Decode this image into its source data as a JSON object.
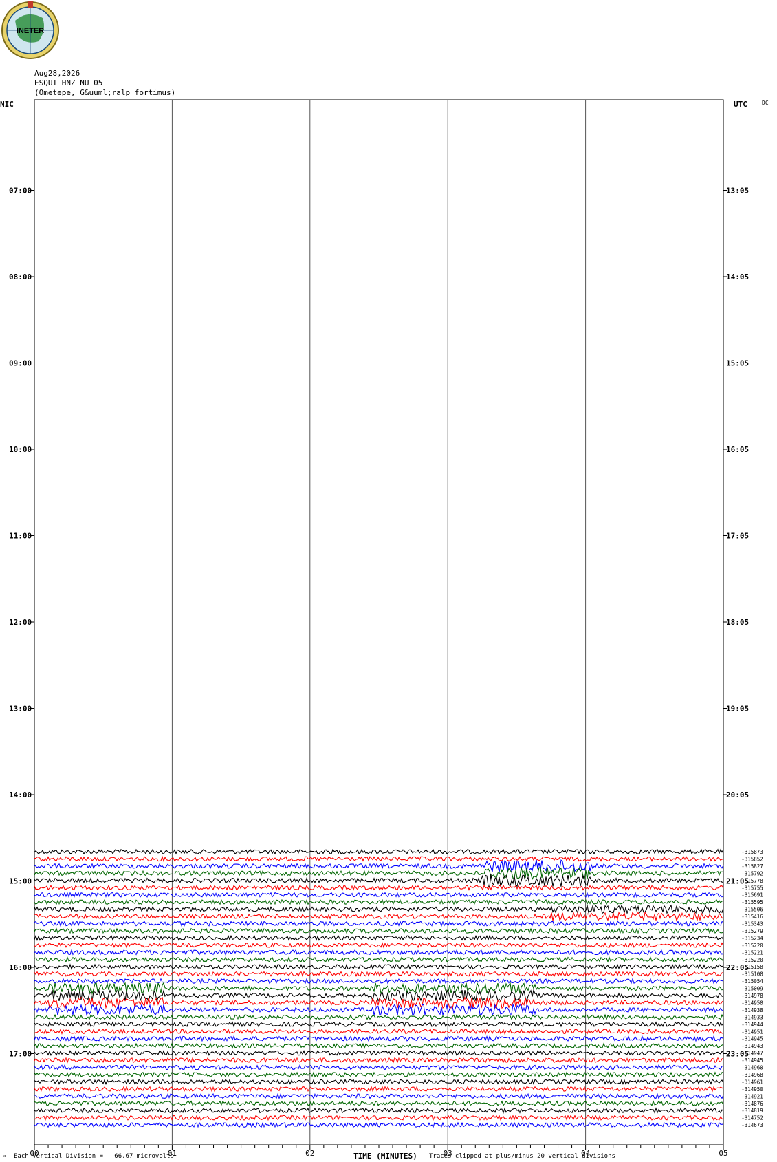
{
  "logo": {
    "text": "INETER"
  },
  "header": {
    "date": "Aug28,2026",
    "station": "ESQUI HNZ NU 05",
    "location": "(Ometepe, G&uuml;ralp fortimus)"
  },
  "axes": {
    "left_label": "NIC",
    "right_label": "UTC",
    "dc_label": "DC",
    "xlabel": "TIME (MINUTES)",
    "x_ticks": [
      "00",
      "01",
      "02",
      "03",
      "04",
      "05"
    ]
  },
  "footer": {
    "scale_note": "Each Vertical Division =   66.67 microvolts",
    "clip_note": "Traces clipped at plus/minus 20 vertical divisions"
  },
  "chart_data": {
    "type": "line",
    "title": "ESQUI HNZ NU 05",
    "left_hours": [
      "07:00",
      "08:00",
      "09:00",
      "10:00",
      "11:00",
      "12:00",
      "13:00",
      "14:00",
      "15:00",
      "16:00",
      "17:00"
    ],
    "right_hours": [
      "13:05",
      "14:05",
      "15:05",
      "16:05",
      "17:05",
      "18:05",
      "19:05",
      "20:05",
      "21:05",
      "22:05",
      "23:05"
    ],
    "trace_colors": [
      "#000000",
      "#ff0000",
      "#0000ff",
      "#006600"
    ],
    "dc_offsets": [
      -315873,
      -315852,
      -315827,
      -315792,
      -315778,
      -315755,
      -315691,
      -315595,
      -315506,
      -315416,
      -315343,
      -315279,
      -315234,
      -315220,
      -315221,
      -315220,
      -315158,
      -315108,
      -315054,
      -315009,
      -314978,
      -314958,
      -314938,
      -314933,
      -314944,
      -314951,
      -314945,
      -314943,
      -314947,
      -314945,
      -314960,
      -314968,
      -314961,
      -314950,
      -314921,
      -314876,
      -314819,
      -314752,
      -314673
    ]
  }
}
